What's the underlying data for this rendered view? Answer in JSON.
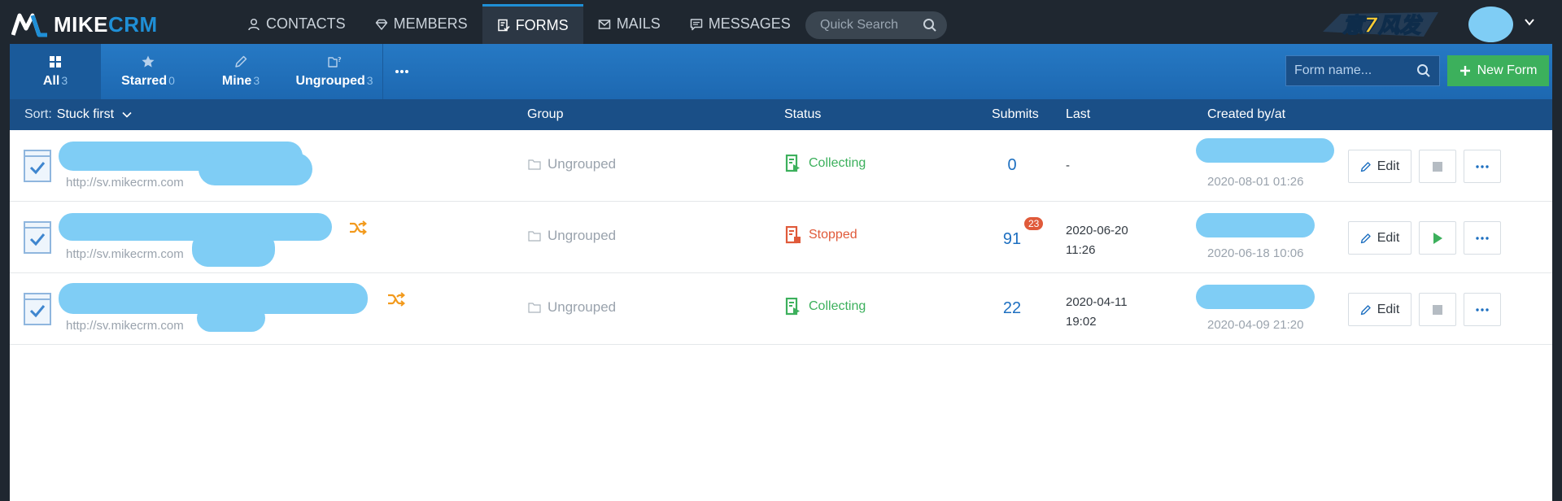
{
  "app": {
    "logo_part1": "MIKE",
    "logo_part2": "CRM",
    "brand_badge_text": "意7风发"
  },
  "nav": {
    "items": [
      {
        "label": "CONTACTS",
        "icon": "user-icon"
      },
      {
        "label": "MEMBERS",
        "icon": "diamond-icon"
      },
      {
        "label": "FORMS",
        "icon": "form-icon",
        "active": true
      },
      {
        "label": "MAILS",
        "icon": "mail-icon"
      },
      {
        "label": "MESSAGES",
        "icon": "message-icon"
      }
    ],
    "search_placeholder": "Quick Search"
  },
  "tabs": [
    {
      "label": "All",
      "count": "3",
      "icon": "grid-icon",
      "active": true
    },
    {
      "label": "Starred",
      "count": "0",
      "icon": "star-icon"
    },
    {
      "label": "Mine",
      "count": "3",
      "icon": "pencil-icon"
    },
    {
      "label": "Ungrouped",
      "count": "3",
      "icon": "folder-question-icon"
    }
  ],
  "toolbar": {
    "form_search_placeholder": "Form name...",
    "new_form_label": "New Form"
  },
  "columns": {
    "sort_label": "Sort:",
    "sort_value": "Stuck first",
    "group": "Group",
    "status": "Status",
    "submits": "Submits",
    "last": "Last",
    "created": "Created by/at"
  },
  "rows": [
    {
      "url": "http://sv.mikecrm.com",
      "group": "Ungrouped",
      "status": "Collecting",
      "submits": "0",
      "new_submits": "",
      "last_date": "-",
      "last_time": "",
      "created_at": "2020-08-01 01:26",
      "edit_label": "Edit"
    },
    {
      "url": "http://sv.mikecrm.com",
      "group": "Ungrouped",
      "status": "Stopped",
      "submits": "91",
      "new_submits": "23",
      "last_date": "2020-06-20",
      "last_time": "11:26",
      "created_at": "2020-06-18 10:06",
      "edit_label": "Edit"
    },
    {
      "url": "http://sv.mikecrm.com",
      "group": "Ungrouped",
      "status": "Collecting",
      "submits": "22",
      "new_submits": "",
      "last_date": "2020-04-11",
      "last_time": "19:02",
      "created_at": "2020-04-09 21:20",
      "edit_label": "Edit"
    }
  ],
  "colors": {
    "accent": "#1f8fd6",
    "collecting": "#3cb05c",
    "stopped": "#e05a3a",
    "redaction": "#7fcdf5"
  }
}
